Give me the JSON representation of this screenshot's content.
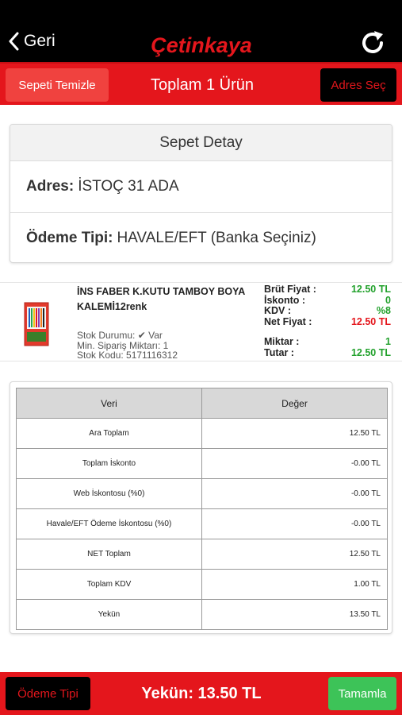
{
  "nav": {
    "back_label": "Geri",
    "logo_text": "Çetinkaya",
    "refresh_icon": "refresh-icon"
  },
  "toolbar": {
    "clear_label": "Sepeti Temizle",
    "title": "Toplam 1 Ürün",
    "address_label": "Adres Seç"
  },
  "detail": {
    "header": "Sepet Detay",
    "address_label": "Adres:",
    "address_value": "İSTOÇ 31 ADA",
    "payment_label": "Ödeme Tipi:",
    "payment_value": "HAVALE/EFT (Banka Seçiniz)"
  },
  "product": {
    "name": "İNS FABER  K.KUTU TAMBOY BOYA KALEMİ12renk",
    "stock_status": "Stok Durumu: ✔ Var",
    "min_order": "Min. Sipariş Miktarı: 1",
    "stock_code": "Stok Kodu: 5171116312",
    "gross_label": "Brüt Fiyat :",
    "gross_value": "12.50 TL",
    "discount_label": "İskonto :",
    "discount_value": "0",
    "vat_label": "KDV :",
    "vat_value": "%8",
    "net_label": "Net Fiyat :",
    "net_value": "12.50 TL",
    "qty_label": "Miktar :",
    "qty_value": "1",
    "amount_label": "Tutar :",
    "amount_value": "12.50 TL"
  },
  "summary": {
    "headers": [
      "Veri",
      "Değer"
    ],
    "rows": [
      [
        "Ara Toplam",
        "12.50 TL"
      ],
      [
        "Toplam İskonto",
        "-0.00 TL"
      ],
      [
        "Web İskontosu (%0)",
        "-0.00 TL"
      ],
      [
        "Havale/EFT Ödeme İskontosu (%0)",
        "-0.00 TL"
      ],
      [
        "NET Toplam",
        "12.50 TL"
      ],
      [
        "Toplam KDV",
        "1.00 TL"
      ],
      [
        "Yekün",
        "13.50 TL"
      ]
    ]
  },
  "footer": {
    "payment_label": "Ödeme Tipi",
    "total_label": "Yekün: 13.50 TL",
    "complete_label": "Tamamla"
  },
  "colors": {
    "brand_red": "#e4161c",
    "accent_green": "#3dc358",
    "price_green": "#22a12c"
  }
}
